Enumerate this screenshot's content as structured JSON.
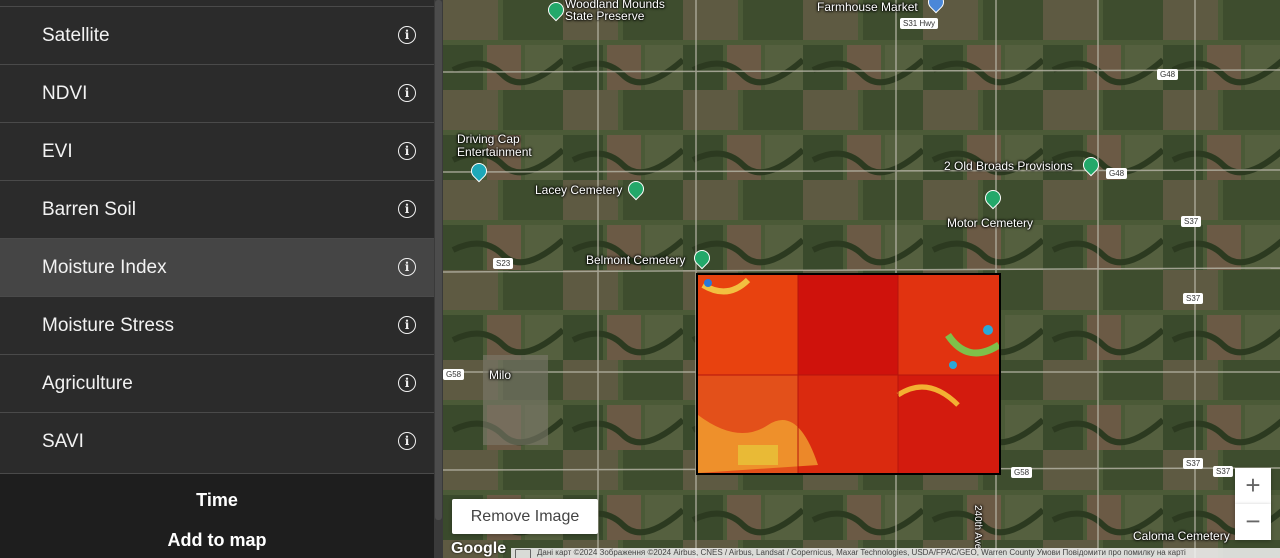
{
  "sidebar": {
    "layers": [
      {
        "label": "Satellite",
        "selected": false
      },
      {
        "label": "NDVI",
        "selected": false
      },
      {
        "label": "EVI",
        "selected": false
      },
      {
        "label": "Barren Soil",
        "selected": false
      },
      {
        "label": "Moisture Index",
        "selected": true
      },
      {
        "label": "Moisture Stress",
        "selected": false
      },
      {
        "label": "Agriculture",
        "selected": false
      },
      {
        "label": "SAVI",
        "selected": false
      }
    ],
    "info_icon": "info-circle-icon",
    "footer_title": "Time",
    "footer_action": "Add to map"
  },
  "map": {
    "labels": {
      "woodland_mounds": "Woodland Mounds\nState Preserve",
      "farmhouse_market": "Farmhouse Market",
      "driving_cap": "Driving Cap\nEntertainment",
      "lacey_cemetery": "Lacey Cemetery",
      "old_broads": "2 Old Broads Provisions",
      "motor_cemetery": "Motor Cemetery",
      "belmont_cemetery": "Belmont Cemetery",
      "milo": "Milo",
      "caloma_cemetery": "Caloma Cemetery",
      "ave_240": "240th Ave"
    },
    "road_shields": {
      "s31": "S31 Hwy",
      "g48_a": "G48",
      "g48_b": "G48",
      "s37_a": "S37",
      "s37_b": "S37",
      "s37_c": "S37",
      "s23": "S23",
      "g58_a": "G58",
      "g58_b": "G58",
      "s37_d": "S37"
    },
    "remove_image_label": "Remove Image",
    "zoom_in": "+",
    "zoom_out": "−",
    "google_logo": "Google",
    "attribution": "Дані карт ©2024 Зображення ©2024 Airbus, CNES / Airbus, Landsat / Copernicus, Maxar Technologies, USDA/FPAC/GEO, Warren County   Умови   Повідомити про помилку на карті",
    "colors": {
      "field_dark": "#3a4a2c",
      "field_brown": "#6b5a45",
      "moisture_red": "#d41a0f",
      "moisture_orange": "#e85a10"
    }
  }
}
